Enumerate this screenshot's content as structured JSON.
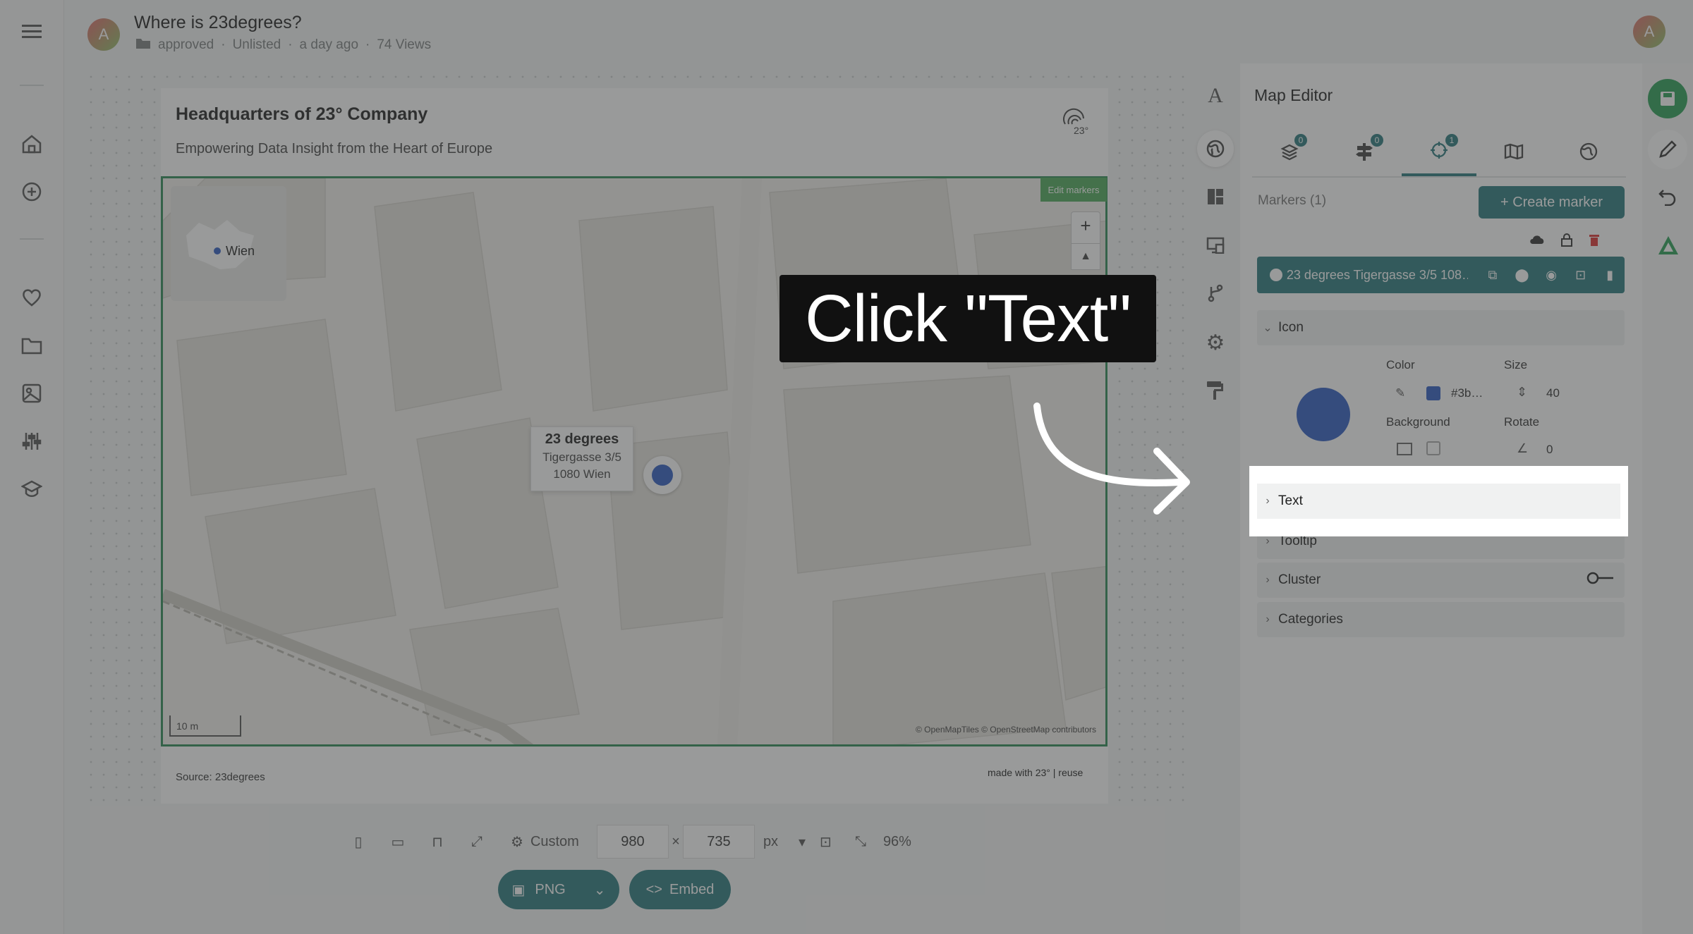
{
  "header": {
    "avatar_letter": "A",
    "title": "Where is 23degrees?",
    "folder": "approved",
    "visibility": "Unlisted",
    "time": "a day ago",
    "views": "74 Views"
  },
  "sidebar": {
    "items": [
      "menu-icon",
      "home-icon",
      "add-icon",
      "heart-icon",
      "folder-icon",
      "image-icon",
      "sliders-icon",
      "learn-icon"
    ]
  },
  "card": {
    "title": "Headquarters of 23° Company",
    "subtitle": "Empowering Data Insight from the Heart of Europe",
    "source": "Source: 23degrees",
    "made_with": "made with 23° | reuse"
  },
  "map": {
    "edit_markers": "Edit markers",
    "inset_label": "Wien",
    "popup": {
      "name": "23 degrees",
      "street": "Tigergasse 3/5",
      "city": "1080 Wien"
    },
    "scale": "10 m",
    "attribution": "© OpenMapTiles © OpenStreetMap contributors",
    "marker_color": "#2f5cc3"
  },
  "editor": {
    "title": "Map Editor",
    "tabs": [
      {
        "icon": "layers-icon",
        "badge": "0"
      },
      {
        "icon": "signpost-icon",
        "badge": "0"
      },
      {
        "icon": "marker-target-icon",
        "badge": "1"
      },
      {
        "icon": "map-icon",
        "badge": ""
      },
      {
        "icon": "globe-icon",
        "badge": ""
      }
    ],
    "markers_label": "Markers (1)",
    "create_marker": "+ Create marker",
    "marker_row": "23 degrees Tigergasse 3/5 108…",
    "sections": {
      "icon": "Icon",
      "text": "Text",
      "tooltip": "Tooltip",
      "cluster": "Cluster",
      "categories": "Categories"
    },
    "icon": {
      "color_label": "Color",
      "color_value": "#3b…",
      "size_label": "Size",
      "size_value": "40",
      "background_label": "Background",
      "rotate_label": "Rotate",
      "rotate_value": "0"
    }
  },
  "bottom": {
    "custom": "Custom",
    "width": "980",
    "times": "×",
    "height": "735",
    "unit": "px",
    "zoom": "96%",
    "png": "PNG",
    "embed": "Embed"
  },
  "callout": {
    "text": "Click \"Text\""
  },
  "accent": "#2a7a7e"
}
